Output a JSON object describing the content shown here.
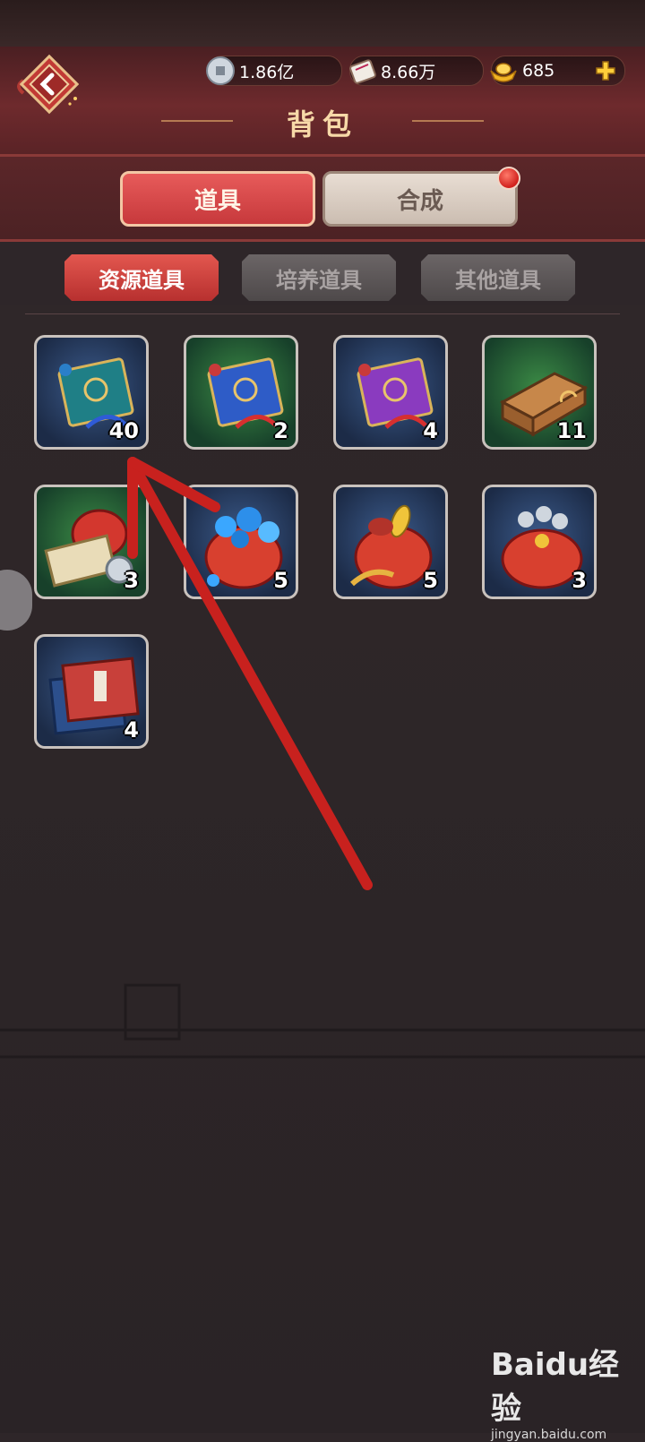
{
  "header": {
    "title": "背包",
    "currencies": [
      {
        "icon": "silver-coin-icon",
        "value": "1.86亿"
      },
      {
        "icon": "scroll-icon",
        "value": "8.66万"
      },
      {
        "icon": "gold-ingot-icon",
        "value": "685"
      }
    ]
  },
  "mode_tabs": [
    {
      "label": "道具",
      "active": true
    },
    {
      "label": "合成",
      "active": false,
      "has_notification": true
    }
  ],
  "sub_tabs": [
    {
      "label": "资源道具",
      "active": true
    },
    {
      "label": "培养道具",
      "active": false
    },
    {
      "label": "其他道具",
      "active": false
    }
  ],
  "items": [
    {
      "icon": "teal-book-icon",
      "bg": "blue",
      "count": "40"
    },
    {
      "icon": "blue-book-icon",
      "bg": "green",
      "count": "2"
    },
    {
      "icon": "purple-book-icon",
      "bg": "blue",
      "count": "4"
    },
    {
      "icon": "treasure-chest-icon",
      "bg": "green",
      "count": "11"
    },
    {
      "icon": "money-bag-icon",
      "bg": "green",
      "count": "3"
    },
    {
      "icon": "gem-pouch-icon",
      "bg": "blue",
      "count": "5"
    },
    {
      "icon": "food-pouch-icon",
      "bg": "blue",
      "count": "5"
    },
    {
      "icon": "coin-pouch-icon",
      "bg": "blue",
      "count": "3"
    },
    {
      "icon": "red-book-icon",
      "bg": "blue",
      "count": "4"
    }
  ],
  "watermark": {
    "logo": "Baidu经验",
    "url": "jingyan.baidu.com"
  },
  "colors": {
    "accent": "#c7393c",
    "frame": "#c9c2bd",
    "annotation": "#c8211e"
  }
}
